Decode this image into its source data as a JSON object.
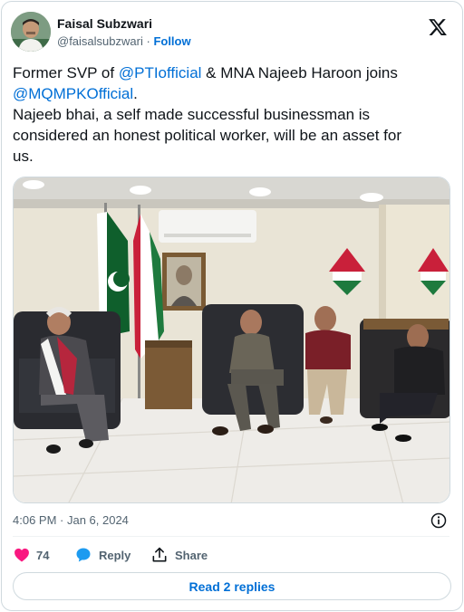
{
  "author": {
    "name": "Faisal Subzwari",
    "handle": "@faisalsubzwari",
    "separator": "·",
    "follow_label": "Follow"
  },
  "tweet": {
    "line1_prefix": "Former SVP of ",
    "line1_mention": "@PTIofficial",
    "line1_suffix": " & MNA Najeeb Haroon joins",
    "line2_mention": "@MQMPKOfficial",
    "line2_suffix": ".",
    "line3": "Najeeb bhai, a self made successful businessman is",
    "line4": "considered an honest political worker, will be an asset for",
    "line5": "us."
  },
  "meta": {
    "timestamp": "4:06 PM · Jan 6, 2024"
  },
  "actions": {
    "like_count": "74",
    "reply_label": "Reply",
    "share_label": "Share"
  },
  "replies_button_label": "Read 2 replies",
  "colors": {
    "link": "#006fd6",
    "like": "#f91880",
    "reply_bubble": "#1d9bf0",
    "muted": "#536471",
    "border": "#cfd9de"
  },
  "icons": {
    "brand": "x-logo-icon",
    "info": "info-icon",
    "like": "heart-icon",
    "reply": "speech-bubble-icon",
    "share": "share-upload-icon"
  }
}
